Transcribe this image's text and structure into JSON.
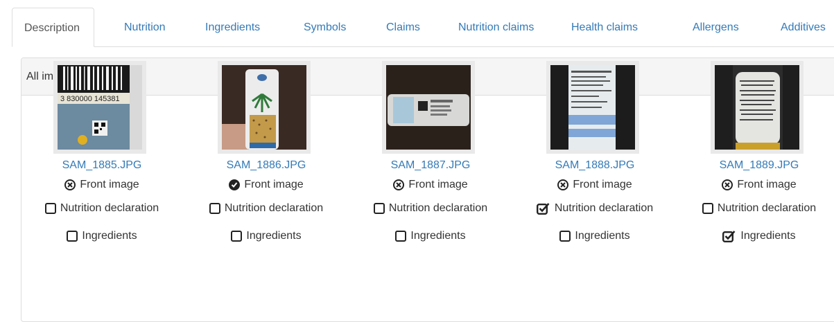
{
  "tabs": [
    {
      "label": "Description",
      "active": true
    },
    {
      "label": "Nutrition"
    },
    {
      "label": "Ingredients"
    },
    {
      "label": "Symbols"
    },
    {
      "label": "Claims"
    },
    {
      "label": "Nutrition claims"
    },
    {
      "label": "Health claims"
    },
    {
      "label": "Allergens"
    },
    {
      "label": "Additives"
    }
  ],
  "panel": {
    "heading": "All images"
  },
  "images": [
    {
      "filename": "SAM_1885.JPG",
      "front_label": "Front image",
      "front_selected": false,
      "nutrition_label": "Nutrition declaration",
      "nutrition_checked": false,
      "ingredients_label": "Ingredients",
      "ingredients_checked": false
    },
    {
      "filename": "SAM_1886.JPG",
      "front_label": "Front image",
      "front_selected": true,
      "nutrition_label": "Nutrition declaration",
      "nutrition_checked": false,
      "ingredients_label": "Ingredients",
      "ingredients_checked": false
    },
    {
      "filename": "SAM_1887.JPG",
      "front_label": "Front image",
      "front_selected": false,
      "nutrition_label": "Nutrition declaration",
      "nutrition_checked": false,
      "ingredients_label": "Ingredients",
      "ingredients_checked": false
    },
    {
      "filename": "SAM_1888.JPG",
      "front_label": "Front image",
      "front_selected": false,
      "nutrition_label": "Nutrition declaration",
      "nutrition_checked": true,
      "ingredients_label": "Ingredients",
      "ingredients_checked": false
    },
    {
      "filename": "SAM_1889.JPG",
      "front_label": "Front image",
      "front_selected": false,
      "nutrition_label": "Nutrition declaration",
      "nutrition_checked": false,
      "ingredients_label": "Ingredients",
      "ingredients_checked": true
    }
  ],
  "barcode_text": "3 830000 145381",
  "colors": {
    "link": "#337ab7",
    "border": "#dddddd",
    "heading_bg": "#f5f5f5"
  },
  "icons": {
    "unselected_front": "times-circle-icon",
    "selected_front": "check-circle-icon",
    "unchecked": "square-o-icon",
    "checked": "check-square-o-icon"
  }
}
